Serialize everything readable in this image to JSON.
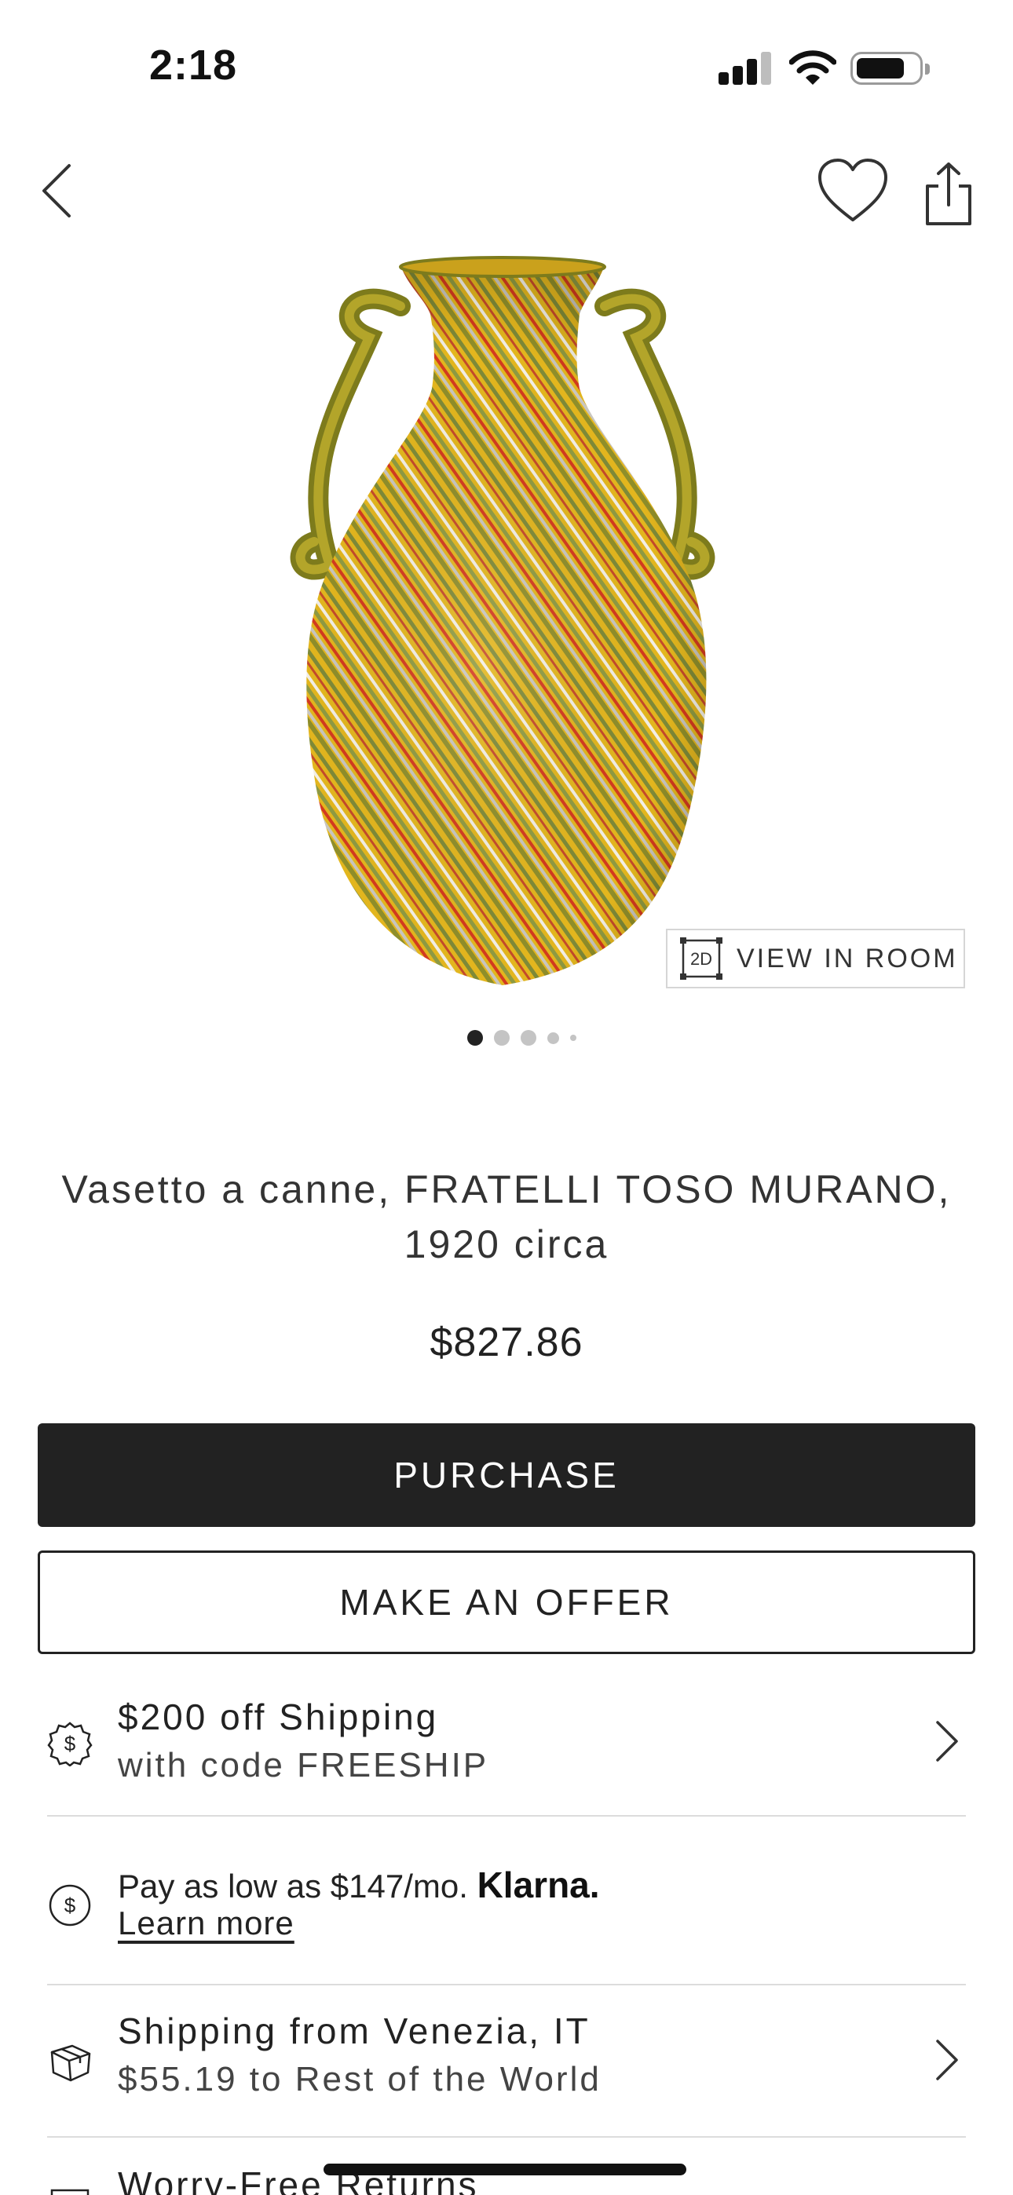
{
  "status_bar": {
    "time": "2:18"
  },
  "product": {
    "title": "Vasetto a canne, FRATELLI TOSO MURANO, 1920 circa",
    "price": "$827.86",
    "image_count": 5,
    "active_image_index": 0
  },
  "view_in_room": {
    "badge": "2D",
    "label": "VIEW IN ROOM"
  },
  "actions": {
    "purchase_label": "PURCHASE",
    "offer_label": "MAKE AN OFFER"
  },
  "info_rows": {
    "promo": {
      "line1": "$200 off Shipping",
      "line2": "with code FREESHIP",
      "icon": "dollar-badge-icon"
    },
    "klarna": {
      "text": "Pay as low as $147/mo.",
      "brand": "Klarna.",
      "link": "Learn more",
      "icon": "dollar-circle-icon"
    },
    "shipping": {
      "line1": "Shipping from Venezia, IT",
      "line2": "$55.19 to Rest of the World",
      "icon": "box-icon"
    },
    "returns": {
      "line1": "Worry-Free Returns",
      "icon": "returns-icon"
    }
  },
  "colors": {
    "primary_button": "#222222",
    "vase_yellow": "#e0b51f"
  }
}
